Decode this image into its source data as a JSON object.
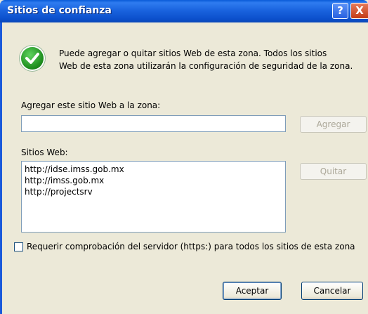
{
  "window": {
    "title": "Sitios de confianza",
    "help_symbol": "?",
    "close_symbol": "X"
  },
  "info": {
    "icon": "checkmark-icon",
    "line1": "Puede agregar o quitar sitios Web de esta zona.  Todos los sitios",
    "line2": "Web de esta zona utilizarán la configuración de seguridad de la zona."
  },
  "add_site": {
    "label": "Agregar este sitio Web a la zona:",
    "value": "",
    "button_label": "Agregar"
  },
  "sites": {
    "label": "Sitios Web:",
    "items": [
      "http://idse.imss.gob.mx",
      "http://imss.gob.mx",
      "http://projectsrv"
    ],
    "remove_label": "Quitar"
  },
  "require_https": {
    "checked": false,
    "label": "Requerir comprobación del servidor (https:) para todos los sitios de esta zona"
  },
  "buttons": {
    "ok": "Aceptar",
    "cancel": "Cancelar"
  },
  "colors": {
    "titlebar": "#0b4fcb",
    "dialog_bg": "#ece9d8",
    "check_green": "#1f8f1f",
    "close_red": "#c33b16"
  }
}
